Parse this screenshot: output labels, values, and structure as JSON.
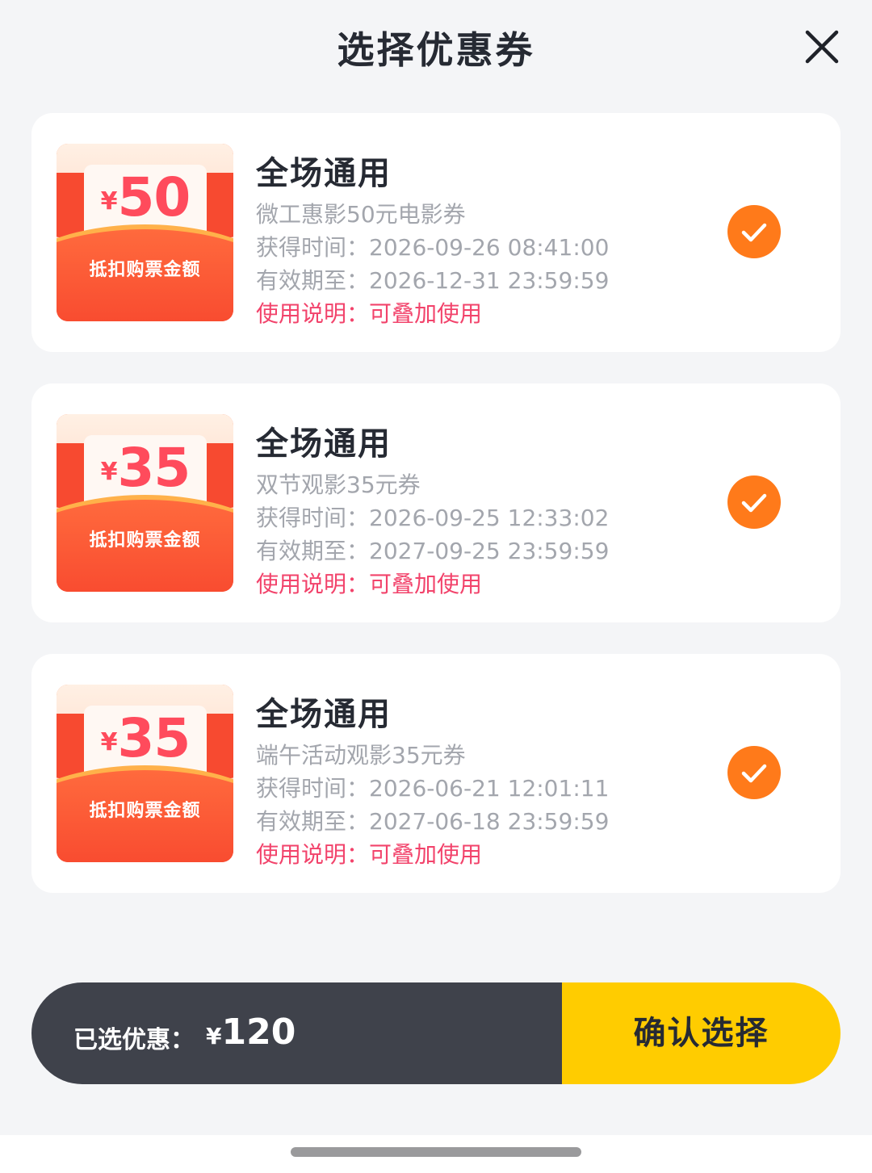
{
  "header": {
    "title": "选择优惠券",
    "close_icon": "close-icon"
  },
  "coupons": [
    {
      "yen": "¥",
      "amount": "50",
      "caption": "抵扣购票金额",
      "title": "全场通用",
      "name": "微工惠影50元电影券",
      "obtained": "获得时间：2026-09-26 08:41:00",
      "expires": "有效期至：2026-12-31 23:59:59",
      "usage": "使用说明：可叠加使用",
      "selected": true
    },
    {
      "yen": "¥",
      "amount": "35",
      "caption": "抵扣购票金额",
      "title": "全场通用",
      "name": "双节观影35元券",
      "obtained": "获得时间：2026-09-25 12:33:02",
      "expires": "有效期至：2027-09-25 23:59:59",
      "usage": "使用说明：可叠加使用",
      "selected": true
    },
    {
      "yen": "¥",
      "amount": "35",
      "caption": "抵扣购票金额",
      "title": "全场通用",
      "name": "端午活动观影35元券",
      "obtained": "获得时间：2026-06-21 12:01:11",
      "expires": "有效期至：2027-06-18 23:59:59",
      "usage": "使用说明：可叠加使用",
      "selected": true
    }
  ],
  "footer": {
    "selected_label": "已选优惠：",
    "yen": "¥",
    "selected_amount": "120",
    "confirm_label": "确认选择"
  },
  "colors": {
    "accent_orange": "#ff7a1a",
    "confirm_yellow": "#ffcc00",
    "summary_dark": "#3f424b",
    "usage_pink": "#f2436b"
  }
}
